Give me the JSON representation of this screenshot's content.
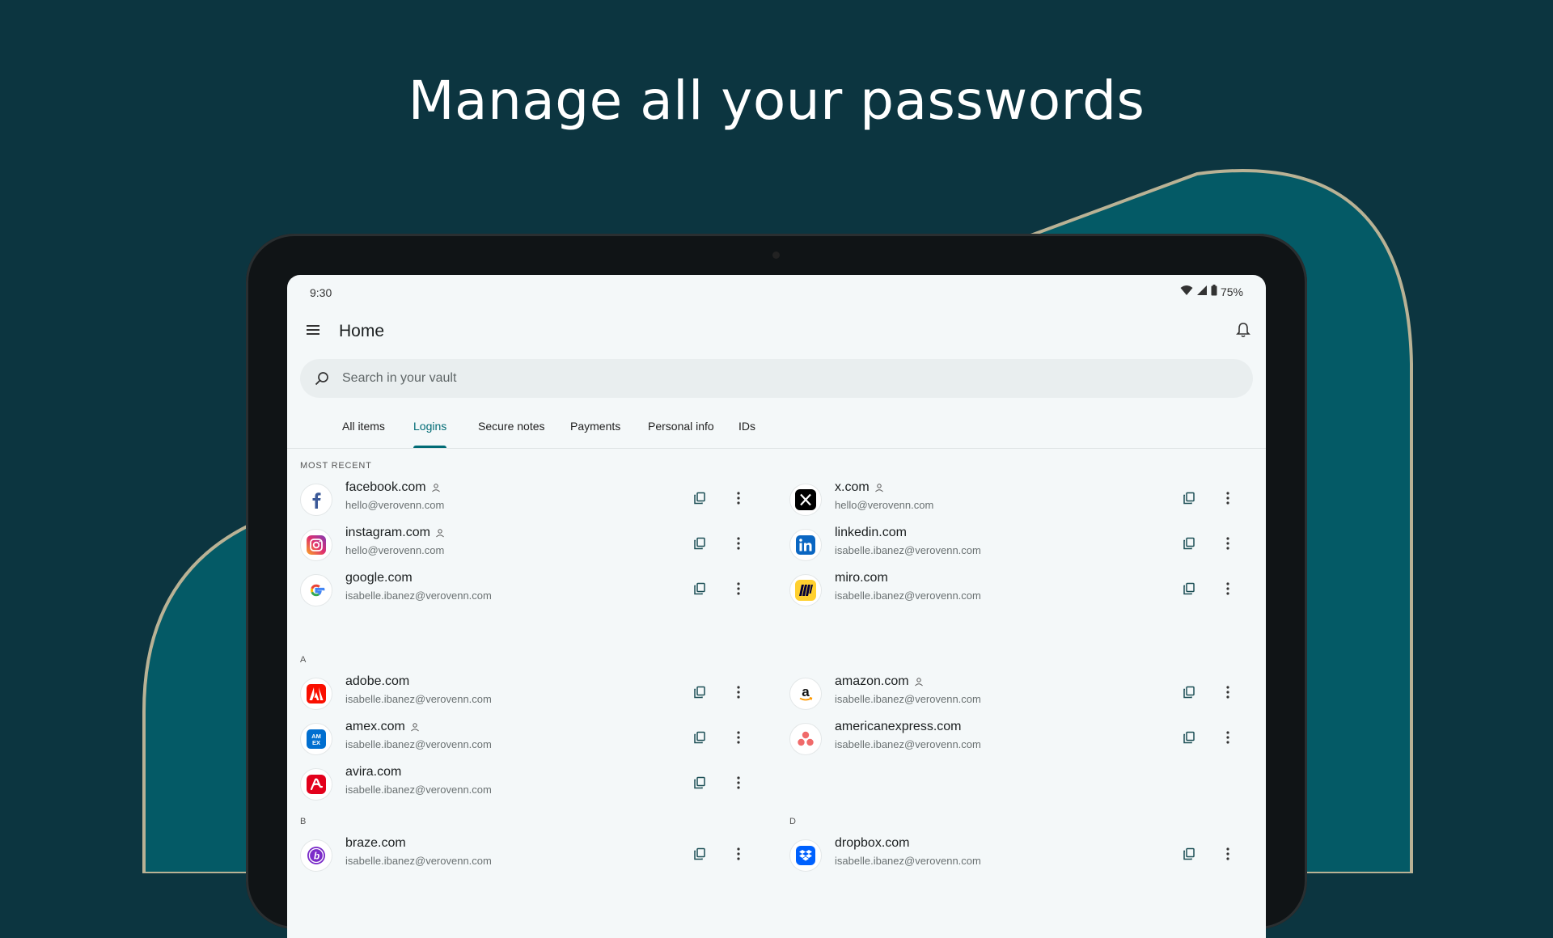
{
  "headline": "Manage all your passwords",
  "status_bar": {
    "time": "9:30",
    "battery": "75%"
  },
  "app_bar": {
    "title": "Home"
  },
  "search": {
    "placeholder": "Search in your vault"
  },
  "tabs": [
    {
      "label": "All items",
      "active": false
    },
    {
      "label": "Logins",
      "active": true
    },
    {
      "label": "Secure notes",
      "active": false
    },
    {
      "label": "Payments",
      "active": false
    },
    {
      "label": "Personal info",
      "active": false
    },
    {
      "label": "IDs",
      "active": false
    }
  ],
  "sections": {
    "most_recent": "MOST RECENT",
    "a": "A",
    "b": "B",
    "d": "D"
  },
  "items": {
    "facebook": {
      "site": "facebook.com",
      "email": "hello@verovenn.com",
      "shared": true,
      "icon": "facebook-icon"
    },
    "x": {
      "site": "x.com",
      "email": "hello@verovenn.com",
      "shared": true,
      "icon": "x-icon"
    },
    "instagram": {
      "site": "instagram.com",
      "email": "hello@verovenn.com",
      "shared": true,
      "icon": "instagram-icon"
    },
    "linkedin": {
      "site": "linkedin.com",
      "email": "isabelle.ibanez@verovenn.com",
      "shared": false,
      "icon": "linkedin-icon"
    },
    "google": {
      "site": "google.com",
      "email": "isabelle.ibanez@verovenn.com",
      "shared": false,
      "icon": "google-icon"
    },
    "miro": {
      "site": "miro.com",
      "email": "isabelle.ibanez@verovenn.com",
      "shared": false,
      "icon": "miro-icon"
    },
    "adobe": {
      "site": "adobe.com",
      "email": "isabelle.ibanez@verovenn.com",
      "shared": false,
      "icon": "adobe-icon"
    },
    "amazon": {
      "site": "amazon.com",
      "email": "isabelle.ibanez@verovenn.com",
      "shared": true,
      "icon": "amazon-icon"
    },
    "amex": {
      "site": "amex.com",
      "email": "isabelle.ibanez@verovenn.com",
      "shared": true,
      "icon": "amex-icon"
    },
    "americanexpress": {
      "site": "americanexpress.com",
      "email": "isabelle.ibanez@verovenn.com",
      "shared": false,
      "icon": "asana-style-icon"
    },
    "avira": {
      "site": "avira.com",
      "email": "isabelle.ibanez@verovenn.com",
      "shared": false,
      "icon": "avira-icon"
    },
    "braze": {
      "site": "braze.com",
      "email": "isabelle.ibanez@verovenn.com",
      "shared": false,
      "icon": "braze-icon"
    },
    "dropbox": {
      "site": "dropbox.com",
      "email": "isabelle.ibanez@verovenn.com",
      "shared": false,
      "icon": "dropbox-icon"
    }
  },
  "colors": {
    "background": "#0c3540",
    "accent": "#006b75",
    "curve_fill": "#045a66",
    "curve_outline": "#b9b295"
  }
}
